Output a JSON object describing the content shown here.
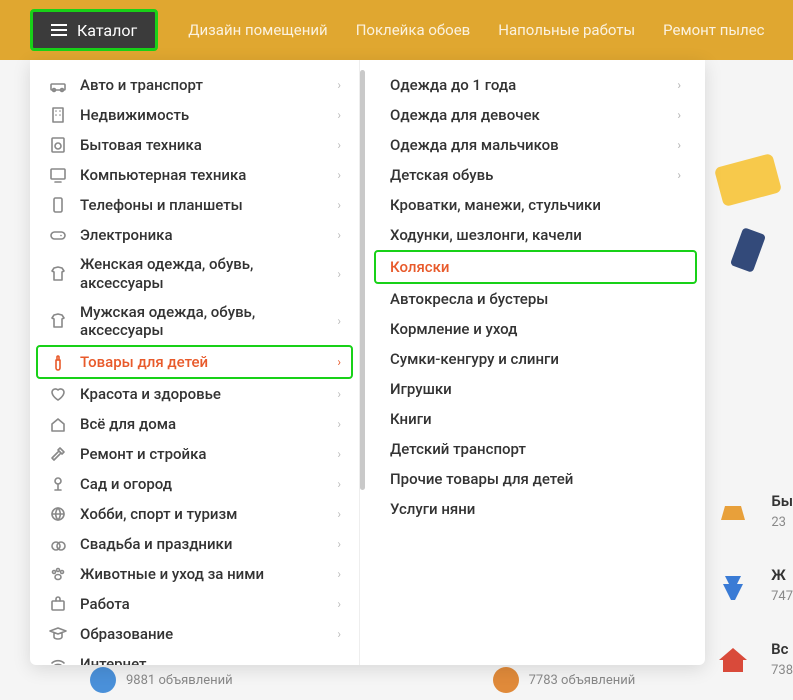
{
  "topbar": {
    "catalog_label": "Каталог",
    "nav": [
      "Дизайн помещений",
      "Поклейка обоев",
      "Напольные работы",
      "Ремонт пылес"
    ]
  },
  "categories": [
    {
      "label": "Авто и транспорт",
      "icon": "car",
      "chev": true
    },
    {
      "label": "Недвижимость",
      "icon": "building",
      "chev": true
    },
    {
      "label": "Бытовая техника",
      "icon": "washer",
      "chev": true
    },
    {
      "label": "Компьютерная техника",
      "icon": "monitor",
      "chev": true
    },
    {
      "label": "Телефоны и планшеты",
      "icon": "phone",
      "chev": true
    },
    {
      "label": "Электроника",
      "icon": "gamepad",
      "chev": true
    },
    {
      "label": "Женская одежда, обувь, аксессуары",
      "icon": "shirt-f",
      "chev": true
    },
    {
      "label": "Мужская одежда, обувь, аксессуары",
      "icon": "shirt-m",
      "chev": true
    },
    {
      "label": "Товары для детей",
      "icon": "baby-bottle",
      "chev": true,
      "active": true
    },
    {
      "label": "Красота и здоровье",
      "icon": "heart",
      "chev": true
    },
    {
      "label": "Всё для дома",
      "icon": "home",
      "chev": true
    },
    {
      "label": "Ремонт и стройка",
      "icon": "hammer",
      "chev": true
    },
    {
      "label": "Сад и огород",
      "icon": "plant",
      "chev": true
    },
    {
      "label": "Хобби, спорт и туризм",
      "icon": "globe",
      "chev": true
    },
    {
      "label": "Свадьба и праздники",
      "icon": "rings",
      "chev": true
    },
    {
      "label": "Животные и уход за ними",
      "icon": "paw",
      "chev": true
    },
    {
      "label": "Работа",
      "icon": "briefcase",
      "chev": true
    },
    {
      "label": "Образование",
      "icon": "gradcap",
      "chev": true
    },
    {
      "label": "Интернет",
      "icon": "wifi",
      "chev": false
    }
  ],
  "subcategories": [
    {
      "label": "Одежда до 1 года",
      "chev": true
    },
    {
      "label": "Одежда для девочек",
      "chev": true
    },
    {
      "label": "Одежда для мальчиков",
      "chev": true
    },
    {
      "label": "Детская обувь",
      "chev": true
    },
    {
      "label": "Кроватки, манежи, стульчики",
      "chev": false
    },
    {
      "label": "Ходунки, шезлонги, качели",
      "chev": false
    },
    {
      "label": "Коляски",
      "chev": false,
      "highlight": true
    },
    {
      "label": "Автокресла и бустеры",
      "chev": false
    },
    {
      "label": "Кормление и уход",
      "chev": false
    },
    {
      "label": "Сумки-кенгуру и слинги",
      "chev": false
    },
    {
      "label": "Игрушки",
      "chev": false
    },
    {
      "label": "Книги",
      "chev": false
    },
    {
      "label": "Детский транспорт",
      "chev": false
    },
    {
      "label": "Прочие товары для детей",
      "chev": false
    },
    {
      "label": "Услуги няни",
      "chev": false
    }
  ],
  "bg_cards": [
    {
      "title": "Бы",
      "sub": "23",
      "color": "#e8a03a"
    },
    {
      "title": "Ж",
      "sub": "747",
      "color": "#3a7bd5"
    },
    {
      "title": "Вс",
      "sub": "738",
      "color": "#d94a3a"
    }
  ],
  "footer": [
    {
      "count": "9881 объявлений"
    },
    {
      "count": "7783 объявлений"
    }
  ]
}
